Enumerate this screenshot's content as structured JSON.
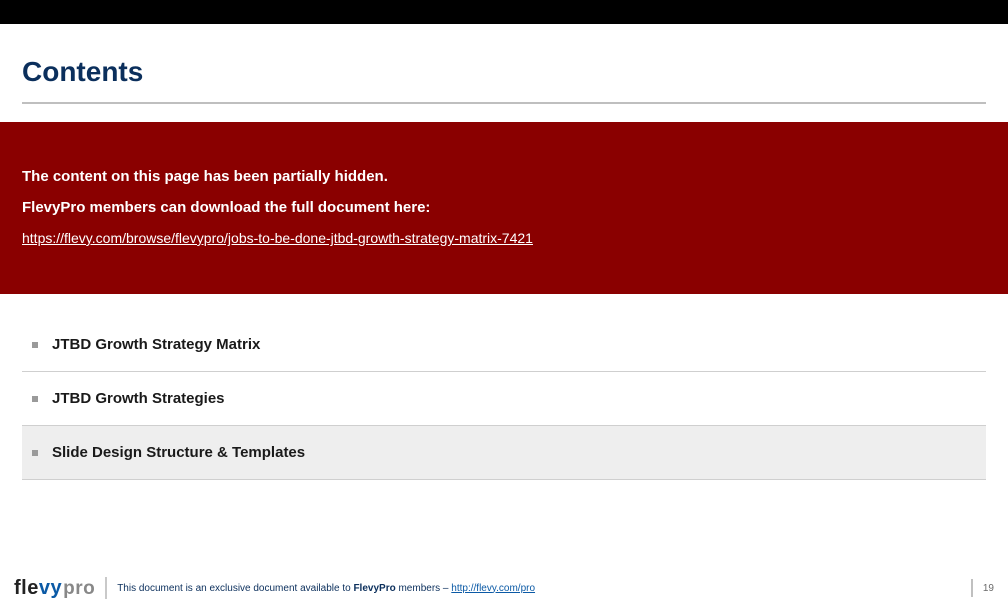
{
  "title": "Contents",
  "banner": {
    "line1": "The content on this page has been partially hidden.",
    "line2": "FlevyPro members can download the full document here:",
    "link": "https://flevy.com/browse/flevypro/jobs-to-be-done-jtbd-growth-strategy-matrix-7421"
  },
  "items": [
    {
      "label": "JTBD Growth Strategy Matrix",
      "highlight": false
    },
    {
      "label": "JTBD Growth Strategies",
      "highlight": false
    },
    {
      "label": "Slide Design Structure & Templates",
      "highlight": true
    }
  ],
  "footer": {
    "logo_fle": "fle",
    "logo_vy": "vy",
    "logo_pro": "pro",
    "text_pre": "This document is an exclusive document available to ",
    "text_bold": "FlevyPro",
    "text_post": " members – ",
    "link": "http://flevy.com/pro",
    "page_num": "19"
  }
}
